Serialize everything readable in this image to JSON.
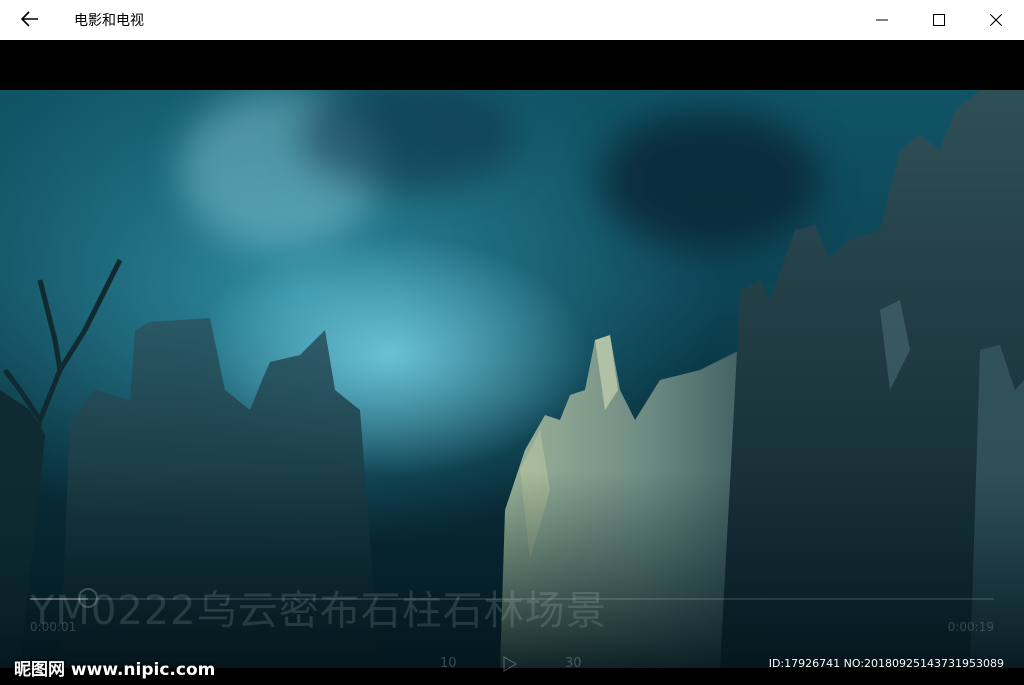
{
  "titlebar": {
    "back_icon": "arrow-left-icon",
    "app_title": "电影和电视",
    "minimize_icon": "minimize-icon",
    "maximize_icon": "maximize-icon",
    "close_icon": "close-icon"
  },
  "player": {
    "overlay_title": "YM0222乌云密布石柱石林场景",
    "elapsed": "0:00:01",
    "remaining": "0:00:19",
    "progress": 0.06,
    "skip_back_label": "10",
    "skip_forward_label": "30"
  },
  "watermarks": {
    "site": "昵图网 www.nipic.com",
    "id_text": "ID:17926741 NO:20180925143731953089"
  },
  "colors": {
    "titlebar_bg": "#ffffff",
    "sky": "#0f5466",
    "letterbox": "#000000"
  }
}
